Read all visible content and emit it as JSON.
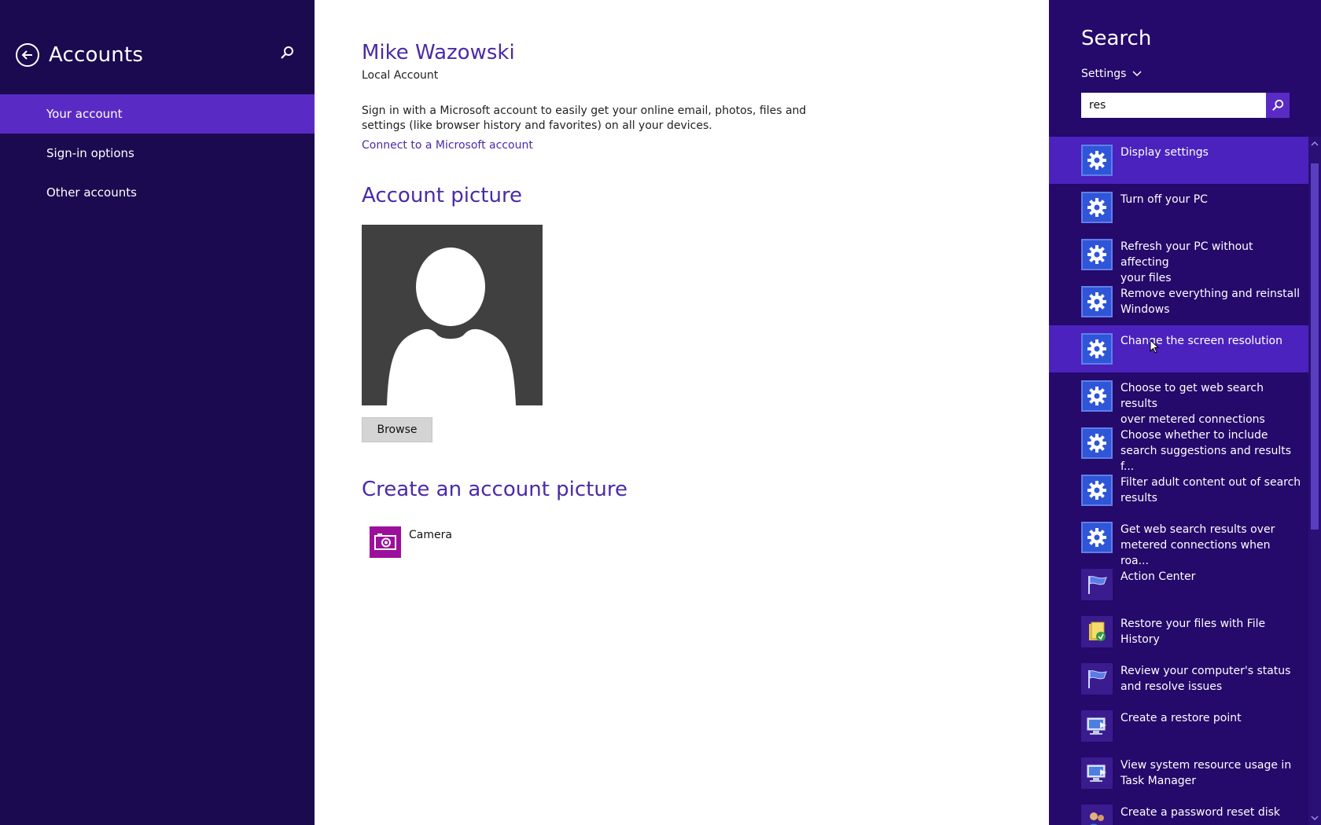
{
  "nav": {
    "title": "Accounts",
    "items": [
      {
        "label": "Your account",
        "active": true
      },
      {
        "label": "Sign-in options",
        "active": false
      },
      {
        "label": "Other accounts",
        "active": false
      }
    ]
  },
  "main": {
    "user_name": "Mike Wazowski",
    "account_type": "Local Account",
    "info_text": "Sign in with a Microsoft account to easily get your online email, photos, files and settings (like browser history and favorites) on all your devices.",
    "connect_link": "Connect to a Microsoft account",
    "picture_title": "Account picture",
    "browse_label": "Browse",
    "create_title": "Create an account picture",
    "camera_label": "Camera"
  },
  "search": {
    "title": "Search",
    "scope": "Settings",
    "query": "res",
    "results": [
      {
        "label": "Display settings",
        "icon": "gear-icon",
        "highlight": true
      },
      {
        "label": "Turn off your PC",
        "icon": "gear-icon",
        "highlight": false
      },
      {
        "label": "Refresh your PC without affecting\nyour files",
        "icon": "gear-icon",
        "highlight": false
      },
      {
        "label": "Remove everything and reinstall\nWindows",
        "icon": "gear-icon",
        "highlight": false
      },
      {
        "label": "Change the screen resolution",
        "icon": "gear-icon",
        "highlight": true
      },
      {
        "label": "Choose to get web search results\nover metered connections",
        "icon": "gear-icon",
        "highlight": false
      },
      {
        "label": "Choose whether to include\nsearch suggestions and results f...",
        "icon": "gear-icon",
        "highlight": false
      },
      {
        "label": "Filter adult content out of search\nresults",
        "icon": "gear-icon",
        "highlight": false
      },
      {
        "label": "Get web search results over\nmetered connections when roa...",
        "icon": "gear-icon",
        "highlight": false
      },
      {
        "label": "Action Center",
        "icon": "flag-icon",
        "highlight": false
      },
      {
        "label": "Restore your files with File\nHistory",
        "icon": "file-history-icon",
        "highlight": false
      },
      {
        "label": "Review your computer's status\nand resolve issues",
        "icon": "flag-icon",
        "highlight": false
      },
      {
        "label": "Create a restore point",
        "icon": "system-icon",
        "highlight": false
      },
      {
        "label": "View system resource usage in\nTask Manager",
        "icon": "system-icon",
        "highlight": false
      },
      {
        "label": "Create a password reset disk",
        "icon": "users-icon",
        "highlight": false
      }
    ]
  }
}
